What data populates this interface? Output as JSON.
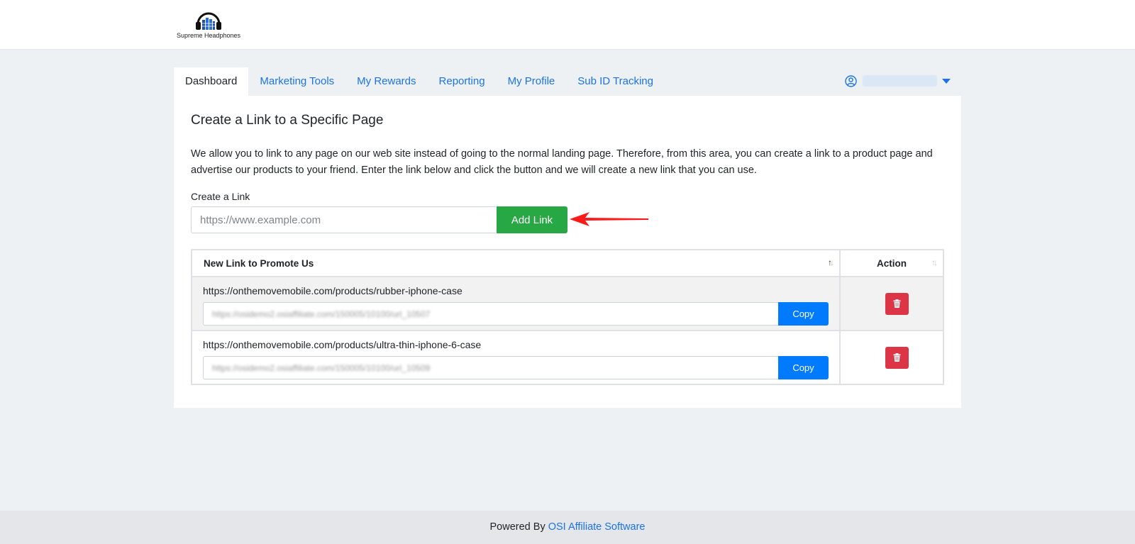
{
  "brand": {
    "logo_text": "Supreme Headphones",
    "logo_icon": "headphones-icon"
  },
  "nav": {
    "tabs": [
      {
        "label": "Dashboard",
        "active": true
      },
      {
        "label": "Marketing Tools",
        "active": false
      },
      {
        "label": "My Rewards",
        "active": false
      },
      {
        "label": "Reporting",
        "active": false
      },
      {
        "label": "My Profile",
        "active": false
      },
      {
        "label": "Sub ID Tracking",
        "active": false
      }
    ],
    "user_icon": "user-circle-icon",
    "dropdown_icon": "caret-down-icon"
  },
  "card": {
    "title": "Create a Link to a Specific Page",
    "description": "We allow you to link to any page on our web site instead of going to the normal landing page. Therefore, from this area, you can create a link to a product page and advertise our products to your friend. Enter the link below and click the button and we will create a new link that you can use.",
    "form": {
      "label": "Create a Link",
      "placeholder": "https://www.example.com",
      "button_label": "Add Link"
    }
  },
  "table": {
    "headers": {
      "link": "New Link to Promote Us",
      "action": "Action"
    },
    "rows": [
      {
        "url": "https://onthemovemobile.com/products/rubber-iphone-case",
        "tracking_link_blurred": "https://osidemo2.osiaffiliate.com/150005/10100/url_10507",
        "copy_label": "Copy"
      },
      {
        "url": "https://onthemovemobile.com/products/ultra-thin-iphone-6-case",
        "tracking_link_blurred": "https://osidemo2.osiaffiliate.com/150005/10100/url_10509",
        "copy_label": "Copy"
      }
    ]
  },
  "footer": {
    "prefix": "Powered By ",
    "link_text": "OSI Affiliate Software"
  },
  "colors": {
    "primary": "#007bff",
    "success": "#28a745",
    "danger": "#dc3545",
    "link": "#1a73e8",
    "annotation_arrow": "#ff1a1a"
  }
}
